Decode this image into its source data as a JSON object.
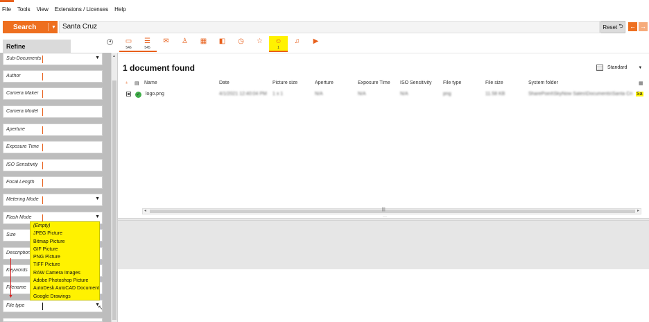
{
  "menu": {
    "items": [
      {
        "label": "File"
      },
      {
        "label": "Tools"
      },
      {
        "label": "View"
      },
      {
        "label": "Extensions / Licenses"
      },
      {
        "label": "Help"
      }
    ]
  },
  "search": {
    "button_label": "Search",
    "query": "Santa Cruz",
    "reset_label": "Reset"
  },
  "refine": {
    "title": "Refine",
    "fields": [
      {
        "label": "Sub-Documents",
        "dropdown": true
      },
      {
        "label": "Author",
        "dropdown": false
      },
      {
        "label": "Camera Maker",
        "dropdown": false
      },
      {
        "label": "Camera Model",
        "dropdown": false
      },
      {
        "label": "Aperture",
        "dropdown": false
      },
      {
        "label": "Exposure Time",
        "dropdown": false
      },
      {
        "label": "ISO Sensitivity",
        "dropdown": false
      },
      {
        "label": "Focal Length",
        "dropdown": false
      },
      {
        "label": "Metering Mode",
        "dropdown": true
      },
      {
        "label": "Flash Mode",
        "dropdown": true
      },
      {
        "label": "Size",
        "dropdown": false
      },
      {
        "label": "Description",
        "dropdown": false
      },
      {
        "label": "Keywords",
        "dropdown": false
      },
      {
        "label": "Filename",
        "dropdown": false
      },
      {
        "label": "File type",
        "dropdown": true
      }
    ],
    "file_type_options": [
      "(Empty)",
      "JPEG Picture",
      "Bitmap Picture",
      "GIF Picture",
      "PNG Picture",
      "TIFF Picture",
      "RAW Camera Images",
      "Adobe Photoshop Picture",
      "AutoDesk AutoCAD Document",
      "Google Drawings"
    ]
  },
  "tabs": [
    {
      "icon": "monitor-icon",
      "count": "546"
    },
    {
      "icon": "list-icon",
      "count": "545"
    },
    {
      "icon": "mail-icon",
      "count": ""
    },
    {
      "icon": "contact-icon",
      "count": ""
    },
    {
      "icon": "calendar-icon",
      "count": ""
    },
    {
      "icon": "presentation-icon",
      "count": ""
    },
    {
      "icon": "history-icon",
      "count": ""
    },
    {
      "icon": "star-icon",
      "count": ""
    },
    {
      "icon": "image-icon",
      "count": "1"
    },
    {
      "icon": "music-icon",
      "count": ""
    },
    {
      "icon": "video-icon",
      "count": ""
    }
  ],
  "results": {
    "summary": "1 document found",
    "view_mode": "Standard",
    "columns": [
      "Name",
      "Date",
      "Picture size",
      "Aperture",
      "Exposure Time",
      "ISO Sensitivity",
      "File type",
      "File size",
      "System folder"
    ],
    "rows": [
      {
        "name": "logo.png",
        "date": "4/1/2021 12:40:04 PM",
        "picture_size": "1 x 1",
        "aperture": "N/A",
        "exposure_time": "N/A",
        "iso": "N/A",
        "file_type": "png",
        "file_size": "11.58 KB",
        "system_folder": "SharePoint\\SkyNow Sales\\Documents\\Santa Cruz",
        "folder_suffix": "Sa"
      }
    ]
  },
  "colors": {
    "accent": "#ee6f1f",
    "highlight": "#fff200",
    "annotation": "#d32121"
  }
}
